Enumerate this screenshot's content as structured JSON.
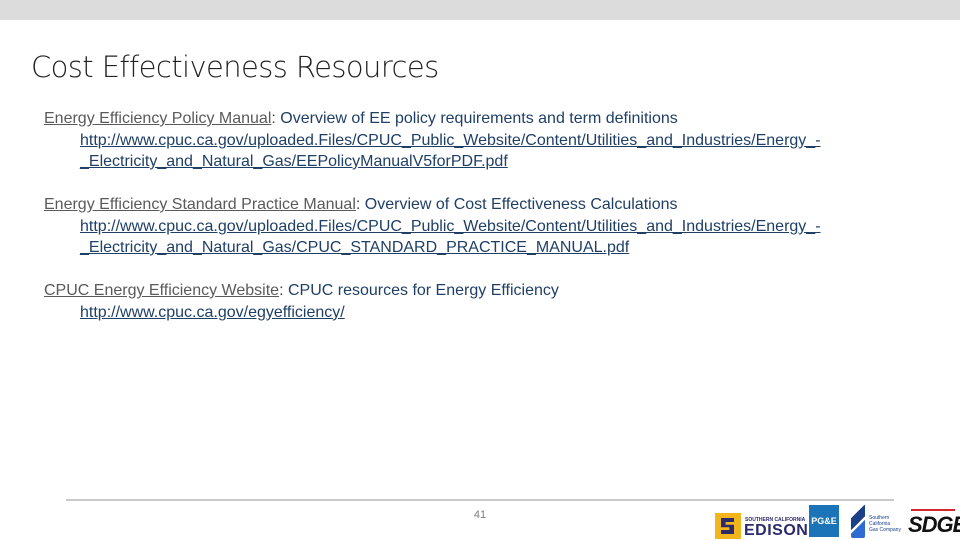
{
  "slide": {
    "title": "Cost Effectiveness Resources",
    "page_number": "41"
  },
  "resources": [
    {
      "name": "Energy Efficiency Policy Manual",
      "separator": ":",
      "description": " Overview of EE policy requirements and term definitions",
      "url_line1": "http://www.cpuc.ca.gov/uploaded.Files/CPUC_Public_Website/Content/Utilities_and_Industries/Energy_-",
      "url_line2": "_Electricity_and_Natural_Gas/EEPolicyManualV5forPDF.pdf"
    },
    {
      "name": "Energy Efficiency Standard Practice Manual",
      "separator": ":",
      "description": " Overview of Cost Effectiveness Calculations",
      "url_line1": "http://www.cpuc.ca.gov/uploaded.Files/CPUC_Public_Website/Content/Utilities_and_Industries/Energy_-",
      "url_line2": "_Electricity_and_Natural_Gas/CPUC_STANDARD_PRACTICE_MANUAL.pdf"
    },
    {
      "name": "CPUC Energy Efficiency Website",
      "separator": ":",
      "description": " CPUC resources for Energy Efficiency",
      "url_line1": "http://www.cpuc.ca.gov/egyefficiency/"
    }
  ],
  "logos": {
    "sce_small": "SOUTHERN CALIFORNIA",
    "sce": "EDISON",
    "pge": "PG&E",
    "socalgas": "Southern\nCalifornia\nGas Company",
    "sdge": "SDGE"
  },
  "colors": {
    "link_text": "#1f3f66",
    "title": "#222222",
    "top_band": "#dcdcdc"
  }
}
